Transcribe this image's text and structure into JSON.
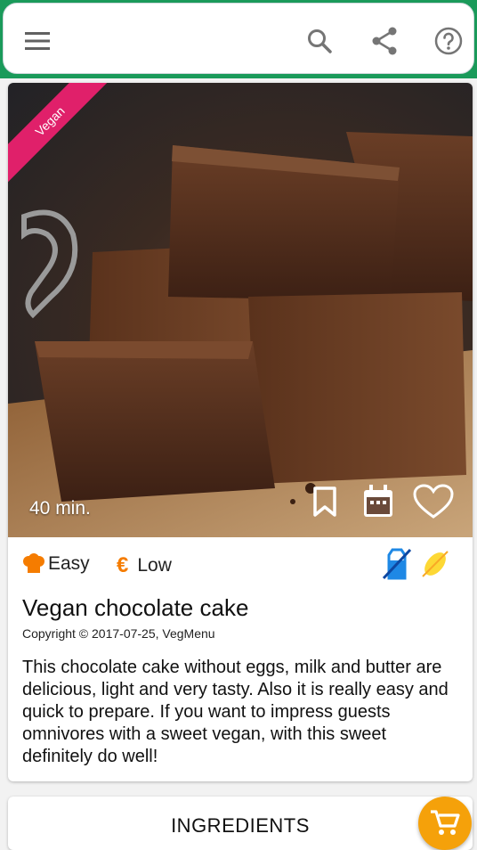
{
  "toolbar": {
    "menu_icon": "menu-icon",
    "search_icon": "search-icon",
    "share_icon": "share-icon",
    "help_icon": "help-icon"
  },
  "recipe": {
    "badge": "Vegan",
    "time": "40 min.",
    "difficulty": "Easy",
    "cost": "Low",
    "title": "Vegan chocolate cake",
    "copyright": "Copyright © 2017-07-25, VegMenu",
    "description": "This chocolate cake without eggs, milk and butter are delicious, light and very tasty. Also it is really easy and quick to prepare. If you want to impress guests omnivores with a sweet vegan, with this sweet definitely do well!"
  },
  "ingredients": {
    "heading": "INGREDIENTS"
  },
  "colors": {
    "header_bar": "#1a9a5a",
    "ribbon": "#e0206a",
    "accent_orange": "#f57c00",
    "fab": "#f5a10a",
    "no_milk_icon": "#1e88e5",
    "no_gluten_icon": "#fdd835"
  }
}
